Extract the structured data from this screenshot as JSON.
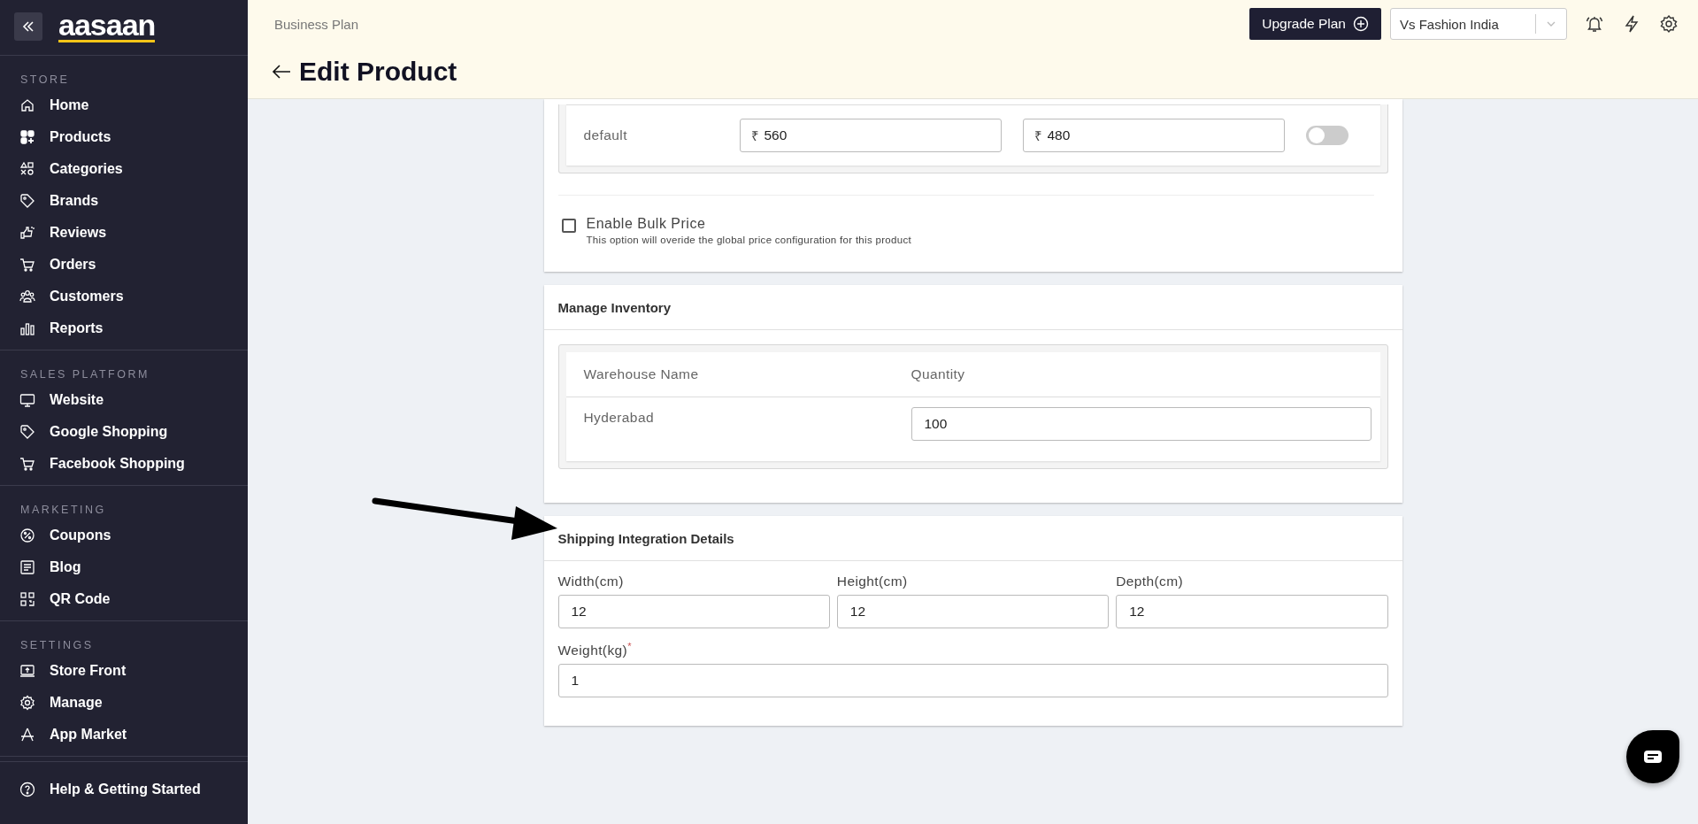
{
  "sidebar": {
    "logo": "aasaan",
    "sections": [
      {
        "title": "STORE",
        "items": [
          {
            "label": "Home"
          },
          {
            "label": "Products"
          },
          {
            "label": "Categories"
          },
          {
            "label": "Brands"
          },
          {
            "label": "Reviews"
          },
          {
            "label": "Orders"
          },
          {
            "label": "Customers"
          },
          {
            "label": "Reports"
          }
        ]
      },
      {
        "title": "SALES PLATFORM",
        "items": [
          {
            "label": "Website"
          },
          {
            "label": "Google Shopping"
          },
          {
            "label": "Facebook Shopping"
          }
        ]
      },
      {
        "title": "MARKETING",
        "items": [
          {
            "label": "Coupons"
          },
          {
            "label": "Blog"
          },
          {
            "label": "QR Code"
          }
        ]
      },
      {
        "title": "SETTINGS",
        "items": [
          {
            "label": "Store Front"
          },
          {
            "label": "Manage"
          },
          {
            "label": "App Market"
          }
        ]
      }
    ],
    "help": "Help & Getting Started"
  },
  "header": {
    "plan": "Business Plan",
    "title": "Edit Product",
    "upgrade_button": "Upgrade Plan",
    "store_select": "Vs Fashion India"
  },
  "pricing": {
    "rows": [
      {
        "name": "default",
        "currency": "₹",
        "price": "560",
        "sale_price": "480",
        "on": false
      }
    ],
    "bulk_price": {
      "label": "Enable Bulk Price",
      "hint": "This option will overide the global price configuration for this product",
      "checked": false
    }
  },
  "inventory": {
    "title": "Manage Inventory",
    "columns": [
      "Warehouse Name",
      "Quantity"
    ],
    "rows": [
      {
        "warehouse": "Hyderabad",
        "quantity": "100"
      }
    ]
  },
  "shipping": {
    "title": "Shipping Integration Details",
    "fields": [
      {
        "label": "Width(cm)",
        "value": "12"
      },
      {
        "label": "Height(cm)",
        "value": "12"
      },
      {
        "label": "Depth(cm)",
        "value": "12"
      },
      {
        "label": "Weight(kg)",
        "required_mark": "*",
        "value": "1"
      }
    ]
  }
}
